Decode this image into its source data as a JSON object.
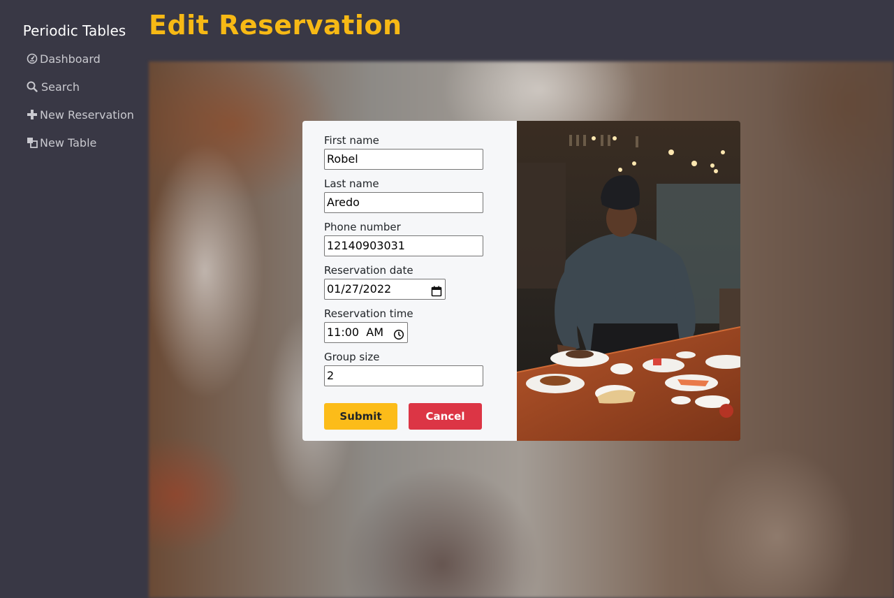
{
  "sidebar": {
    "brand": "Periodic Tables",
    "items": [
      {
        "label": "Dashboard",
        "icon": "dashboard-icon"
      },
      {
        "label": "Search",
        "icon": "search-icon"
      },
      {
        "label": "New Reservation",
        "icon": "plus-icon"
      },
      {
        "label": "New Table",
        "icon": "table-icon"
      }
    ]
  },
  "header": {
    "title": "Edit Reservation"
  },
  "form": {
    "first_name": {
      "label": "First name",
      "value": "Robel"
    },
    "last_name": {
      "label": "Last name",
      "value": "Aredo"
    },
    "phone": {
      "label": "Phone number",
      "value": "12140903031"
    },
    "date": {
      "label": "Reservation date",
      "value": "01/27/2022"
    },
    "time": {
      "label": "Reservation time",
      "value": "11:00  AM"
    },
    "people": {
      "label": "Group size",
      "value": "2"
    },
    "submit_label": "Submit",
    "cancel_label": "Cancel"
  },
  "colors": {
    "background": "#393845",
    "title": "#f7b915",
    "submit": "#fcbc19",
    "cancel": "#dc3545"
  }
}
